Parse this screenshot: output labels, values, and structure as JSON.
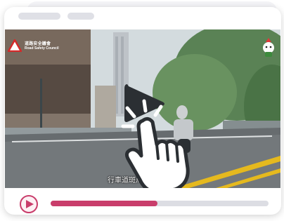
{
  "window": {
    "pill_count": 2
  },
  "video": {
    "logo_name": "道路安全議會",
    "logo_subname": "Road Safety Council",
    "subtitle": "行車道斑馬線上的行人",
    "progress_fraction": 0.49
  },
  "colors": {
    "accent": "#c93d6b",
    "track": "#dcdde3",
    "road_marking": "#f2c320"
  },
  "icons": {
    "play_overlay": "play-icon",
    "hand": "pointing-hand-icon",
    "controls_play": "play-icon",
    "logo": "warning-triangle-icon",
    "mascot": "mascot-icon"
  }
}
